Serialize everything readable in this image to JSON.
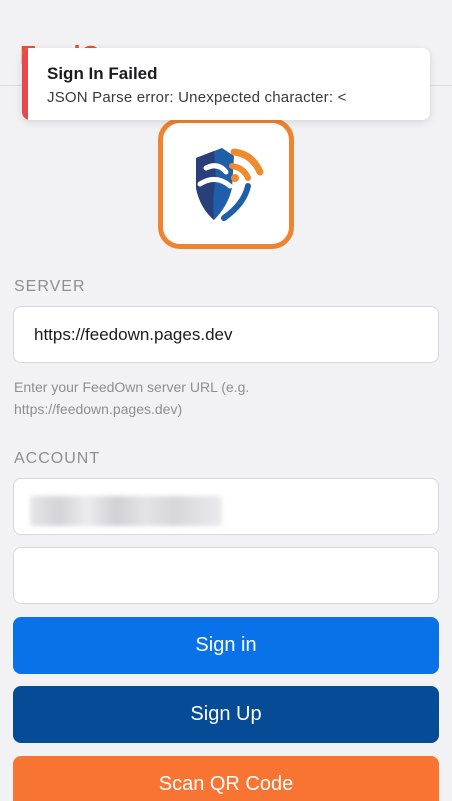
{
  "header": {
    "brand_fragment": "FeedO"
  },
  "toast": {
    "title": "Sign In Failed",
    "message": "JSON Parse error: Unexpected character: <",
    "accent_color": "#e8474c"
  },
  "logo": {
    "icon": "feedown-shield-rss-logo"
  },
  "server": {
    "section_label": "SERVER",
    "url_value": "https://feedown.pages.dev",
    "hint": "Enter your FeedOwn server URL (e.g. https://feedown.pages.dev)"
  },
  "account": {
    "section_label": "ACCOUNT",
    "email_value": "",
    "password_value": ""
  },
  "buttons": {
    "sign_in": "Sign in",
    "sign_up": "Sign Up",
    "scan_qr": "Scan QR Code"
  },
  "colors": {
    "primary": "#0a72e8",
    "secondary": "#064b95",
    "accent": "#f77433",
    "error": "#e8474c"
  }
}
